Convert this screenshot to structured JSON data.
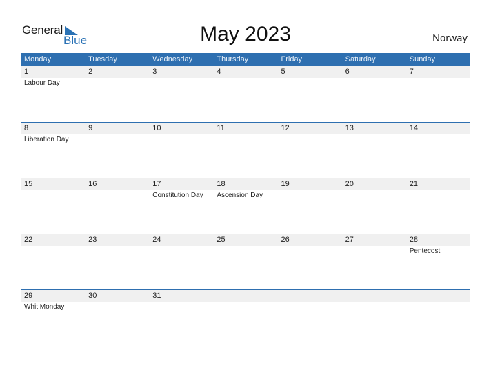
{
  "logo": {
    "general": "General",
    "blue": "Blue"
  },
  "title": "May 2023",
  "country": "Norway",
  "colors": {
    "accent": "#2e6fb0",
    "strip": "#f0f0f0"
  },
  "weekdays": [
    "Monday",
    "Tuesday",
    "Wednesday",
    "Thursday",
    "Friday",
    "Saturday",
    "Sunday"
  ],
  "weeks": [
    {
      "days": [
        "1",
        "2",
        "3",
        "4",
        "5",
        "6",
        "7"
      ],
      "holidays": [
        "Labour Day",
        "",
        "",
        "",
        "",
        "",
        ""
      ]
    },
    {
      "days": [
        "8",
        "9",
        "10",
        "11",
        "12",
        "13",
        "14"
      ],
      "holidays": [
        "Liberation Day",
        "",
        "",
        "",
        "",
        "",
        ""
      ]
    },
    {
      "days": [
        "15",
        "16",
        "17",
        "18",
        "19",
        "20",
        "21"
      ],
      "holidays": [
        "",
        "",
        "Constitution Day",
        "Ascension Day",
        "",
        "",
        ""
      ]
    },
    {
      "days": [
        "22",
        "23",
        "24",
        "25",
        "26",
        "27",
        "28"
      ],
      "holidays": [
        "",
        "",
        "",
        "",
        "",
        "",
        "Pentecost"
      ]
    },
    {
      "days": [
        "29",
        "30",
        "31",
        "",
        "",
        "",
        ""
      ],
      "holidays": [
        "Whit Monday",
        "",
        "",
        "",
        "",
        "",
        ""
      ]
    }
  ]
}
